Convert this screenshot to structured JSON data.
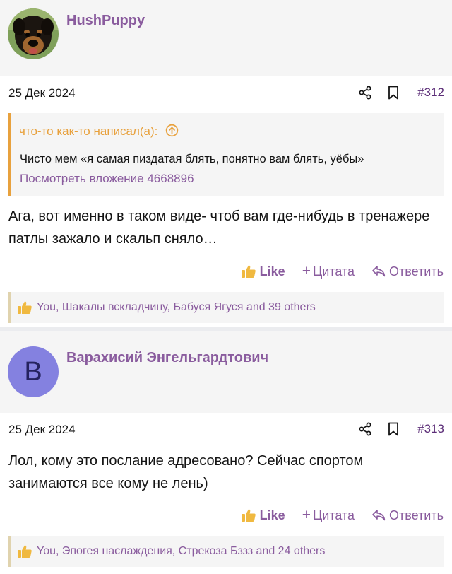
{
  "posts": [
    {
      "username": "HushPuppy",
      "date": "25 Дек 2024",
      "number": "#312",
      "quote": {
        "author_line": "что-то как-то написал(а):",
        "text": "Чисто мем «я самая пиздатая блять, понятно вам блять, уёбы»",
        "attachment_link": "Посмотреть вложение 4668896"
      },
      "body": "Ага, вот именно в таком виде- чтоб вам где-нибудь в тренажере патлы зажало и скальп сняло…",
      "actions": {
        "like": "Like",
        "quote": "Цитата",
        "reply": "Ответить"
      },
      "reactions": "You, Шакалы вскладчину, Бабуся Ягуся and 39 others"
    },
    {
      "username": "Варахисий Энгельгардтович",
      "avatar_letter": "B",
      "date": "25 Дек 2024",
      "number": "#313",
      "body": "Лол, кому это послание адресовано? Сейчас спортом занимаются все кому не лень)",
      "actions": {
        "like": "Like",
        "quote": "Цитата",
        "reply": "Ответить"
      },
      "reactions": "You, Эпогея наслаждения, Стрекоза Бззз and 24 others"
    }
  ],
  "colors": {
    "accent": "#8a5c9e",
    "quote_border": "#e8a13d",
    "avatar_bg": "#8481e0",
    "like_thumb": "#f0b940"
  }
}
